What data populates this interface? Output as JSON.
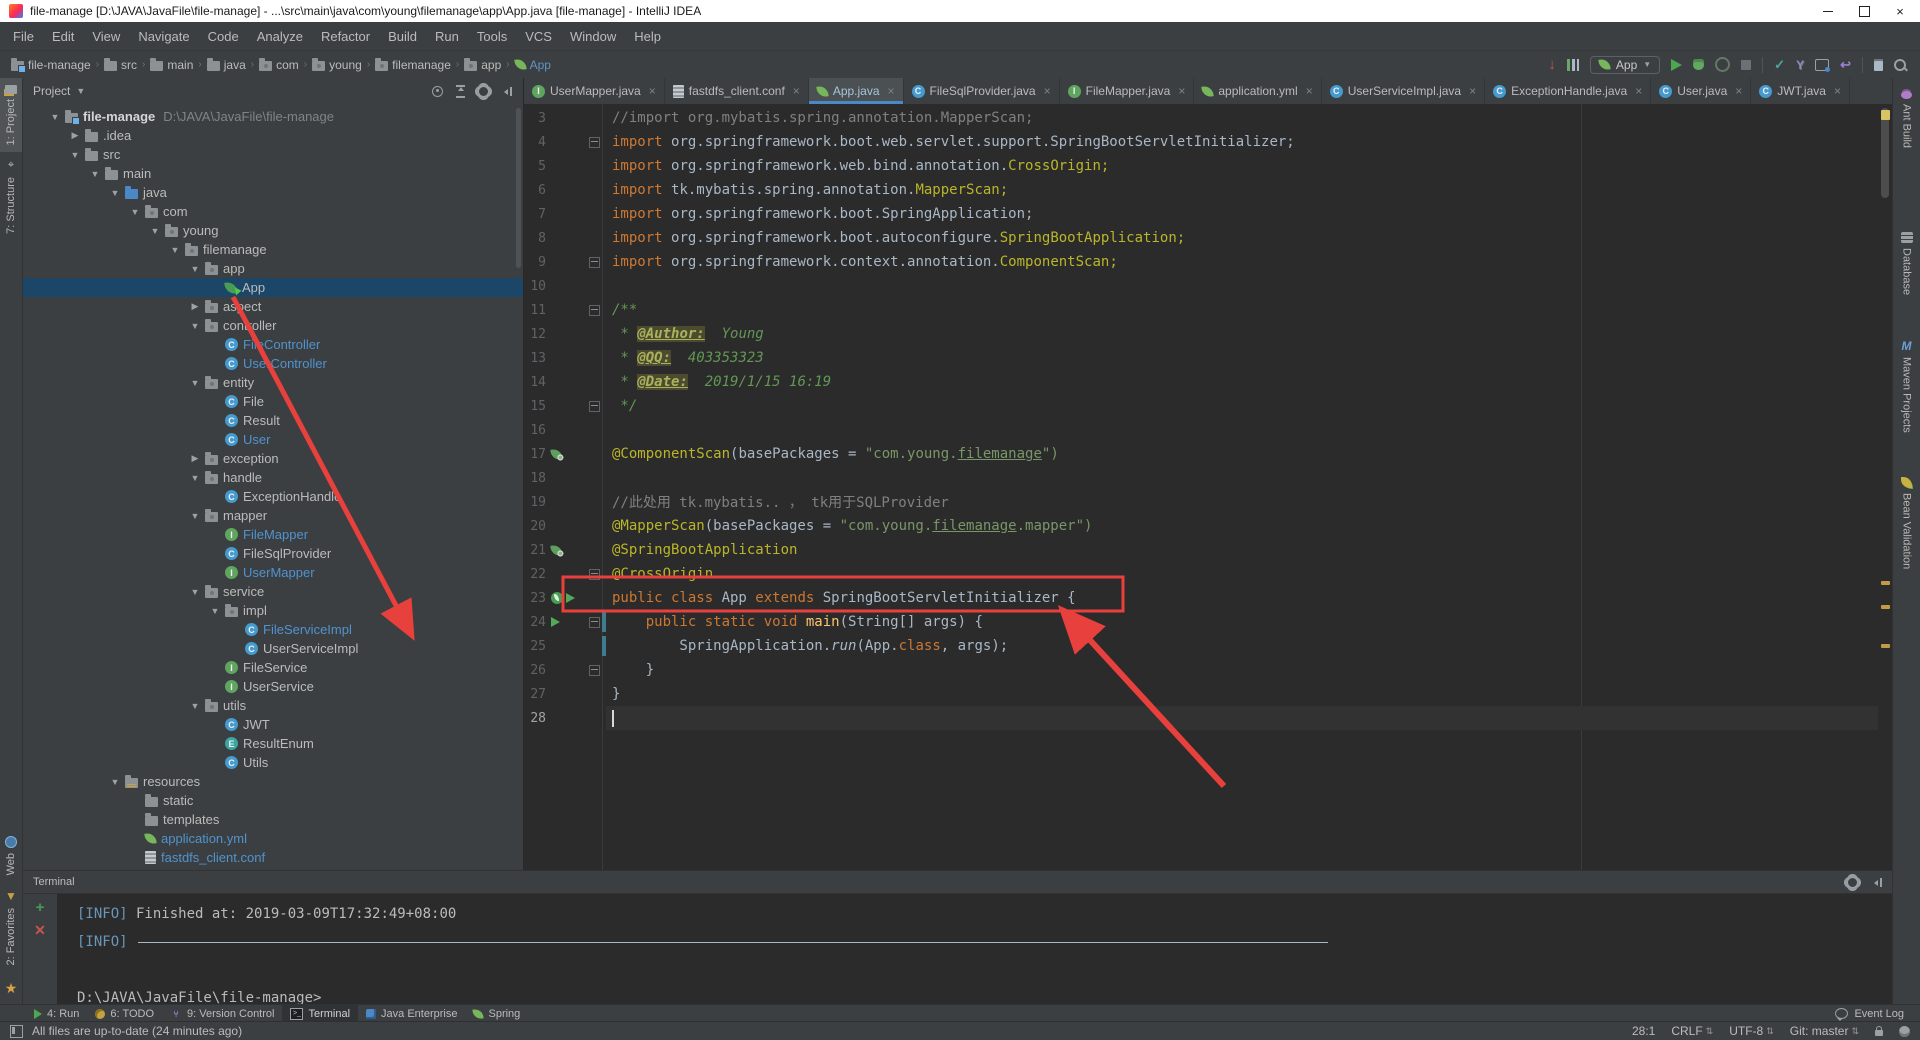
{
  "window": {
    "title": "file-manage [D:\\JAVA\\JavaFile\\file-manage] - ...\\src\\main\\java\\com\\young\\filemanage\\app\\App.java [file-manage] - IntelliJ IDEA"
  },
  "menu_bar": {
    "items": [
      "File",
      "Edit",
      "View",
      "Navigate",
      "Code",
      "Analyze",
      "Refactor",
      "Build",
      "Run",
      "Tools",
      "VCS",
      "Window",
      "Help"
    ]
  },
  "nav_bar": {
    "breadcrumbs": [
      {
        "label": "file-manage",
        "icon": "project"
      },
      {
        "label": "src",
        "icon": "folder"
      },
      {
        "label": "main",
        "icon": "folder"
      },
      {
        "label": "java",
        "icon": "folder"
      },
      {
        "label": "com",
        "icon": "pkg"
      },
      {
        "label": "young",
        "icon": "pkg"
      },
      {
        "label": "filemanage",
        "icon": "pkg"
      },
      {
        "label": "app",
        "icon": "pkg"
      },
      {
        "label": "App",
        "icon": "spring",
        "accent": true
      }
    ],
    "run_config": "App"
  },
  "left_stripe": {
    "top": [
      {
        "label": "1: Project",
        "icon": "project",
        "active": true
      },
      {
        "label": "7: Structure",
        "icon": "structure"
      }
    ],
    "bottom": [
      {
        "label": "Web",
        "icon": "web"
      },
      {
        "label": "2: Favorites",
        "icon": "favorites"
      }
    ]
  },
  "right_stripe": {
    "items": [
      {
        "label": "Ant Build",
        "icon": "ant"
      },
      {
        "label": "Database",
        "icon": "database"
      },
      {
        "label": "Maven Projects",
        "icon": "maven"
      },
      {
        "label": "Bean Validation",
        "icon": "bean"
      }
    ]
  },
  "project_panel": {
    "title": "Project",
    "tree": [
      {
        "d": 0,
        "a": "o",
        "i": "project",
        "t": "file-manage",
        "s": "D:\\JAVA\\JavaFile\\file-manage",
        "b": true
      },
      {
        "d": 1,
        "a": "c",
        "i": "folder",
        "t": ".idea"
      },
      {
        "d": 1,
        "a": "o",
        "i": "folder",
        "t": "src"
      },
      {
        "d": 2,
        "a": "o",
        "i": "folder",
        "t": "main"
      },
      {
        "d": 3,
        "a": "o",
        "i": "srcfolder",
        "t": "java"
      },
      {
        "d": 4,
        "a": "o",
        "i": "pkg",
        "t": "com"
      },
      {
        "d": 5,
        "a": "o",
        "i": "pkg",
        "t": "young"
      },
      {
        "d": 6,
        "a": "o",
        "i": "pkg",
        "t": "filemanage"
      },
      {
        "d": 7,
        "a": "o",
        "i": "pkg",
        "t": "app"
      },
      {
        "d": 8,
        "a": "",
        "i": "springrun",
        "t": "App",
        "sel": true
      },
      {
        "d": 7,
        "a": "c",
        "i": "pkg",
        "t": "aspect"
      },
      {
        "d": 7,
        "a": "o",
        "i": "pkg",
        "t": "controller"
      },
      {
        "d": 8,
        "a": "",
        "i": "class",
        "t": "FileController",
        "c": "blue"
      },
      {
        "d": 8,
        "a": "",
        "i": "class",
        "t": "UserController",
        "c": "blue"
      },
      {
        "d": 7,
        "a": "o",
        "i": "pkg",
        "t": "entity"
      },
      {
        "d": 8,
        "a": "",
        "i": "class",
        "t": "File"
      },
      {
        "d": 8,
        "a": "",
        "i": "class",
        "t": "Result"
      },
      {
        "d": 8,
        "a": "",
        "i": "class",
        "t": "User",
        "c": "blue"
      },
      {
        "d": 7,
        "a": "c",
        "i": "pkg",
        "t": "exception"
      },
      {
        "d": 7,
        "a": "o",
        "i": "pkg",
        "t": "handle"
      },
      {
        "d": 8,
        "a": "",
        "i": "class",
        "t": "ExceptionHandle"
      },
      {
        "d": 7,
        "a": "o",
        "i": "pkg",
        "t": "mapper"
      },
      {
        "d": 8,
        "a": "",
        "i": "iface",
        "t": "FileMapper",
        "c": "blue"
      },
      {
        "d": 8,
        "a": "",
        "i": "class",
        "t": "FileSqlProvider"
      },
      {
        "d": 8,
        "a": "",
        "i": "iface",
        "t": "UserMapper",
        "c": "blue"
      },
      {
        "d": 7,
        "a": "o",
        "i": "pkg",
        "t": "service"
      },
      {
        "d": 8,
        "a": "o",
        "i": "pkg",
        "t": "impl"
      },
      {
        "d": 9,
        "a": "",
        "i": "class",
        "t": "FileServiceImpl",
        "c": "blue"
      },
      {
        "d": 9,
        "a": "",
        "i": "class",
        "t": "UserServiceImpl"
      },
      {
        "d": 8,
        "a": "",
        "i": "iface",
        "t": "FileService"
      },
      {
        "d": 8,
        "a": "",
        "i": "iface",
        "t": "UserService"
      },
      {
        "d": 7,
        "a": "o",
        "i": "pkg",
        "t": "utils"
      },
      {
        "d": 8,
        "a": "",
        "i": "class",
        "t": "JWT"
      },
      {
        "d": 8,
        "a": "",
        "i": "enum",
        "t": "ResultEnum"
      },
      {
        "d": 8,
        "a": "",
        "i": "class",
        "t": "Utils"
      },
      {
        "d": 3,
        "a": "o",
        "i": "resfolder",
        "t": "resources"
      },
      {
        "d": 4,
        "a": "",
        "i": "folder",
        "t": "static"
      },
      {
        "d": 4,
        "a": "",
        "i": "folder",
        "t": "templates"
      },
      {
        "d": 4,
        "a": "",
        "i": "yml",
        "t": "application.yml",
        "c": "blue"
      },
      {
        "d": 4,
        "a": "",
        "i": "conf",
        "t": "fastdfs_client.conf",
        "c": "blue"
      }
    ]
  },
  "editor": {
    "tabs": [
      {
        "label": "UserMapper.java",
        "icon": "iface"
      },
      {
        "label": "fastdfs_client.conf",
        "icon": "conf"
      },
      {
        "label": "App.java",
        "icon": "spring",
        "active": true
      },
      {
        "label": "FileSqlProvider.java",
        "icon": "class"
      },
      {
        "label": "FileMapper.java",
        "icon": "iface"
      },
      {
        "label": "application.yml",
        "icon": "yml"
      },
      {
        "label": "UserServiceImpl.java",
        "icon": "class"
      },
      {
        "label": "ExceptionHandle.java",
        "icon": "class"
      },
      {
        "label": "User.java",
        "icon": "class"
      },
      {
        "label": "JWT.java",
        "icon": "class"
      }
    ],
    "code": [
      {
        "n": 3,
        "seg": [
          [
            "cm",
            "//import org.mybatis.spring.annotation.MapperScan;"
          ]
        ]
      },
      {
        "n": 4,
        "fold": "m",
        "seg": [
          [
            "kw",
            "import "
          ],
          [
            "pl",
            "org.springframework.boot.web.servlet.support.SpringBootServletInitializer;"
          ]
        ]
      },
      {
        "n": 5,
        "seg": [
          [
            "kw",
            "import "
          ],
          [
            "pl",
            "org.springframework.web.bind.annotation."
          ],
          [
            "cls",
            "CrossOrigin;"
          ]
        ]
      },
      {
        "n": 6,
        "seg": [
          [
            "kw",
            "import "
          ],
          [
            "pl",
            "tk.mybatis.spring.annotation."
          ],
          [
            "cls",
            "MapperScan;"
          ]
        ]
      },
      {
        "n": 7,
        "seg": [
          [
            "kw",
            "import "
          ],
          [
            "pl",
            "org.springframework.boot.SpringApplication;"
          ]
        ]
      },
      {
        "n": 8,
        "seg": [
          [
            "kw",
            "import "
          ],
          [
            "pl",
            "org.springframework.boot.autoconfigure."
          ],
          [
            "cls",
            "SpringBootApplication;"
          ]
        ]
      },
      {
        "n": 9,
        "fold": "e",
        "seg": [
          [
            "kw",
            "import "
          ],
          [
            "pl",
            "org.springframework.context.annotation."
          ],
          [
            "cls",
            "ComponentScan;"
          ]
        ]
      },
      {
        "n": 10,
        "seg": []
      },
      {
        "n": 11,
        "fold": "m",
        "seg": [
          [
            "doc",
            "/**"
          ]
        ]
      },
      {
        "n": 12,
        "seg": [
          [
            "doc",
            " * "
          ],
          [
            "doctag",
            "@Author:"
          ],
          [
            "doc",
            "  Young"
          ]
        ]
      },
      {
        "n": 13,
        "seg": [
          [
            "doc",
            " * "
          ],
          [
            "doctag",
            "@QQ:"
          ],
          [
            "doc",
            "  403353323"
          ]
        ]
      },
      {
        "n": 14,
        "seg": [
          [
            "doc",
            " * "
          ],
          [
            "doctag",
            "@Date:"
          ],
          [
            "doc",
            "  2019/1/15 16:19"
          ]
        ]
      },
      {
        "n": 15,
        "fold": "e",
        "seg": [
          [
            "doc",
            " */"
          ]
        ]
      },
      {
        "n": 16,
        "seg": []
      },
      {
        "n": 17,
        "g": [
          "spring"
        ],
        "seg": [
          [
            "ann",
            "@ComponentScan"
          ],
          [
            "pl",
            "(basePackages = "
          ],
          [
            "str",
            "\"com.young."
          ],
          [
            "stru",
            "filemanage"
          ],
          [
            "str",
            "\")"
          ]
        ]
      },
      {
        "n": 18,
        "seg": []
      },
      {
        "n": 19,
        "seg": [
          [
            "cm",
            "//此处用 tk.mybatis.. ， tk用于SQLProvider"
          ]
        ]
      },
      {
        "n": 20,
        "seg": [
          [
            "ann",
            "@MapperScan"
          ],
          [
            "pl",
            "(basePackages = "
          ],
          [
            "str",
            "\"com.young."
          ],
          [
            "stru",
            "filemanage"
          ],
          [
            "str",
            ".mapper\")"
          ]
        ]
      },
      {
        "n": 21,
        "g": [
          "spring"
        ],
        "seg": [
          [
            "ann",
            "@SpringBootApplication"
          ]
        ]
      },
      {
        "n": 22,
        "fold": "m",
        "seg": [
          [
            "ann",
            "@CrossOrigin"
          ]
        ]
      },
      {
        "n": 23,
        "g": [
          "boot",
          "run"
        ],
        "seg": [
          [
            "kw",
            "public class "
          ],
          [
            "pl",
            "App "
          ],
          [
            "kw",
            "extends "
          ],
          [
            "pl",
            "SpringBootServletInitializer {"
          ]
        ]
      },
      {
        "n": 24,
        "g": [
          "run"
        ],
        "fold": "m",
        "vcs": true,
        "seg": [
          [
            "pl",
            "    "
          ],
          [
            "kw",
            "public static void "
          ],
          [
            "fn",
            "main"
          ],
          [
            "pl",
            "(String[] args) {"
          ]
        ]
      },
      {
        "n": 25,
        "vcs": true,
        "seg": [
          [
            "pl",
            "        SpringApplication."
          ],
          [
            "it",
            "run"
          ],
          [
            "pl",
            "(App."
          ],
          [
            "kw",
            "class"
          ],
          [
            "pl",
            ", args);"
          ]
        ]
      },
      {
        "n": 26,
        "fold": "e",
        "seg": [
          [
            "pl",
            "    }"
          ]
        ]
      },
      {
        "n": 27,
        "seg": [
          [
            "pl",
            "}"
          ]
        ]
      },
      {
        "n": 28,
        "caret": true,
        "seg": []
      }
    ]
  },
  "terminal": {
    "title": "Terminal",
    "lines": [
      {
        "type": "info",
        "tag": "[INFO]",
        "text": " Finished at: 2019-03-09T17:32:49+08:00"
      },
      {
        "type": "rule",
        "tag": "[INFO]",
        "rule": "------------------------------------------------------------------------"
      },
      {
        "type": "blank",
        "text": ""
      },
      {
        "type": "prompt",
        "text": "D:\\JAVA\\JavaFile\\file-manage>"
      }
    ]
  },
  "bottom_bar": {
    "left": [
      {
        "label": "4: Run",
        "icon": "run"
      },
      {
        "label": "6: TODO",
        "icon": "todo"
      },
      {
        "label": "9: Version Control",
        "icon": "vcs"
      },
      {
        "label": "Terminal",
        "icon": "term",
        "active": true
      },
      {
        "label": "Java Enterprise",
        "icon": "javaee"
      },
      {
        "label": "Spring",
        "icon": "spring"
      }
    ],
    "event_log": "Event Log"
  },
  "status_bar": {
    "left": "All files are up-to-date (24 minutes ago)",
    "right": [
      {
        "label": "28:1"
      },
      {
        "label": "CRLF",
        "caret": true
      },
      {
        "label": "UTF-8",
        "caret": true
      },
      {
        "label": "Git: master",
        "caret": true
      }
    ]
  },
  "colors": {
    "annotation_red": "#E8403C",
    "selection_blue": "#1C4668",
    "tab_underline": "#4A88C7",
    "spring_green": "#77B65A",
    "run_green": "#4DA652",
    "open_file_blue": "#5093CE",
    "editor_bg": "#2B2B2B",
    "panel_bg": "#3C3F41"
  }
}
